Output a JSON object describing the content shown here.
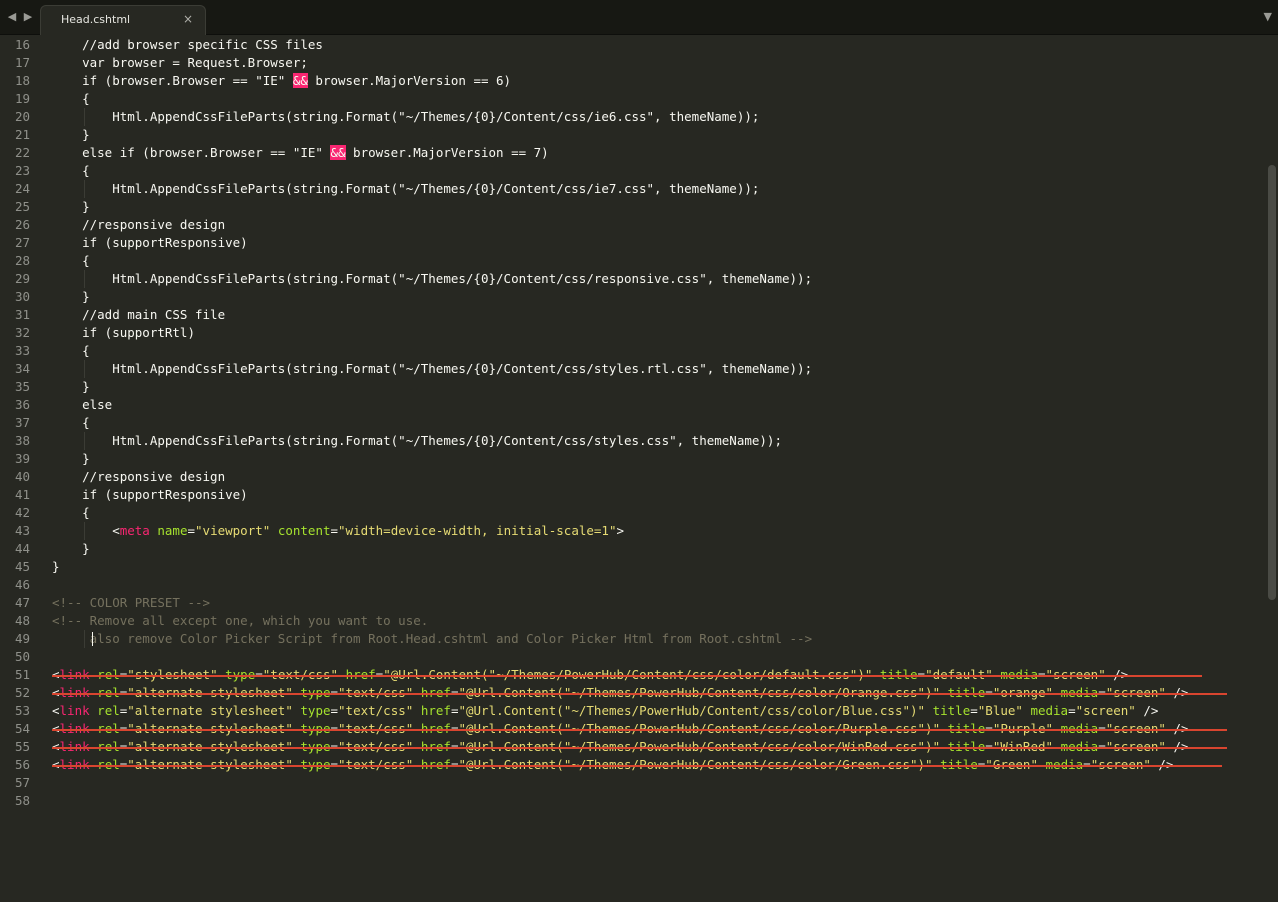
{
  "tabs": [
    {
      "label": "Head.cshtml",
      "close": "×"
    }
  ],
  "nav": {
    "back": "◀",
    "forward": "▶",
    "menu": "▼"
  },
  "lines": [
    {
      "n": "16",
      "html": "    //add browser specific CSS files"
    },
    {
      "n": "17",
      "html": "    var browser = Request.Browser;"
    },
    {
      "n": "18",
      "html": "    if (browser.Browser == \"IE\" <span class=\"amp\">&amp;&amp;</span> browser.MajorVersion == 6)"
    },
    {
      "n": "19",
      "html": "    {"
    },
    {
      "n": "20",
      "html": "        Html.AppendCssFileParts(string.Format(\"~/Themes/{0}/Content/css/ie6.css\", themeName));"
    },
    {
      "n": "21",
      "html": "    }"
    },
    {
      "n": "22",
      "html": "    else if (browser.Browser == \"IE\" <span class=\"amp\">&amp;&amp;</span> browser.MajorVersion == 7)"
    },
    {
      "n": "23",
      "html": "    {"
    },
    {
      "n": "24",
      "html": "        Html.AppendCssFileParts(string.Format(\"~/Themes/{0}/Content/css/ie7.css\", themeName));"
    },
    {
      "n": "25",
      "html": "    }"
    },
    {
      "n": "26",
      "html": "    //responsive design"
    },
    {
      "n": "27",
      "html": "    if (supportResponsive)"
    },
    {
      "n": "28",
      "html": "    {"
    },
    {
      "n": "29",
      "html": "        Html.AppendCssFileParts(string.Format(\"~/Themes/{0}/Content/css/responsive.css\", themeName));"
    },
    {
      "n": "30",
      "html": "    }"
    },
    {
      "n": "31",
      "html": "    //add main CSS file"
    },
    {
      "n": "32",
      "html": "    if (supportRtl)"
    },
    {
      "n": "33",
      "html": "    {"
    },
    {
      "n": "34",
      "html": "        Html.AppendCssFileParts(string.Format(\"~/Themes/{0}/Content/css/styles.rtl.css\", themeName));"
    },
    {
      "n": "35",
      "html": "    }"
    },
    {
      "n": "36",
      "html": "    else"
    },
    {
      "n": "37",
      "html": "    {"
    },
    {
      "n": "38",
      "html": "        Html.AppendCssFileParts(string.Format(\"~/Themes/{0}/Content/css/styles.css\", themeName));"
    },
    {
      "n": "39",
      "html": "    }"
    },
    {
      "n": "40",
      "html": "    //responsive design"
    },
    {
      "n": "41",
      "html": "    if (supportResponsive)"
    },
    {
      "n": "42",
      "html": "    {"
    },
    {
      "n": "43",
      "html": "        &lt;<span class=\"tg\">meta</span> <span class=\"at\">name</span>=<span class=\"st\">\"viewport\"</span> <span class=\"at\">content</span>=<span class=\"st\">\"width=device-width, initial-scale=1\"</span>&gt;"
    },
    {
      "n": "44",
      "html": "    }"
    },
    {
      "n": "45",
      "html": "}"
    },
    {
      "n": "46",
      "html": ""
    },
    {
      "n": "47",
      "html": "&lt;!-- COLOR PRESET --&gt;",
      "dim": true
    },
    {
      "n": "48",
      "html": "&lt;!-- Remove all except one, which you want to use.",
      "dim": true
    },
    {
      "n": "49",
      "html": "     also remove Color Picker Script from Root.Head.cshtml and Color Picker Html from Root.cshtml --&gt;",
      "dim": true
    },
    {
      "n": "50",
      "html": ""
    },
    {
      "n": "51",
      "html": "&lt;<span class=\"tg\">link</span> <span class=\"at\">rel</span>=<span class=\"st\">\"stylesheet\"</span> <span class=\"at\">type</span>=<span class=\"st\">\"text/css\"</span> <span class=\"at\">href</span>=<span class=\"st\">\"@Url.Content(\"~/Themes/PowerHub/Content/css/color/default.css\")\"</span> <span class=\"at\">title</span>=<span class=\"st\">\"default\"</span> <span class=\"at\">media</span>=<span class=\"st\">\"screen\"</span> /&gt;",
      "strike": 1150
    },
    {
      "n": "52",
      "html": "&lt;<span class=\"tg\">link</span> <span class=\"at\">rel</span>=<span class=\"st\">\"alternate stylesheet\"</span> <span class=\"at\">type</span>=<span class=\"st\">\"text/css\"</span> <span class=\"at\">href</span>=<span class=\"st\">\"@Url.Content(\"~/Themes/PowerHub/Content/css/color/Orange.css\")\"</span> <span class=\"at\">title</span>=<span class=\"st\">\"orange\"</span> <span class=\"at\">media</span>=<span class=\"st\">\"screen\"</span> /&gt;",
      "strike": 1175
    },
    {
      "n": "53",
      "html": "&lt;<span class=\"tg\">link</span> <span class=\"at\">rel</span>=<span class=\"st\">\"alternate stylesheet\"</span> <span class=\"at\">type</span>=<span class=\"st\">\"text/css\"</span> <span class=\"at\">href</span>=<span class=\"st\">\"@Url.Content(\"~/Themes/PowerHub/Content/css/color/Blue.css\")\"</span> <span class=\"at\">title</span>=<span class=\"st\">\"Blue\"</span> <span class=\"at\">media</span>=<span class=\"st\">\"screen\"</span> /&gt;"
    },
    {
      "n": "54",
      "html": "&lt;<span class=\"tg\">link</span> <span class=\"at\">rel</span>=<span class=\"st\">\"alternate stylesheet\"</span> <span class=\"at\">type</span>=<span class=\"st\">\"text/css\"</span> <span class=\"at\">href</span>=<span class=\"st\">\"@Url.Content(\"~/Themes/PowerHub/Content/css/color/Purple.css\")\"</span> <span class=\"at\">title</span>=<span class=\"st\">\"Purple\"</span> <span class=\"at\">media</span>=<span class=\"st\">\"screen\"</span> /&gt;",
      "strike": 1175
    },
    {
      "n": "55",
      "html": "&lt;<span class=\"tg\">link</span> <span class=\"at\">rel</span>=<span class=\"st\">\"alternate stylesheet\"</span> <span class=\"at\">type</span>=<span class=\"st\">\"text/css\"</span> <span class=\"at\">href</span>=<span class=\"st\">\"@Url.Content(\"~/Themes/PowerHub/Content/css/color/WinRed.css\")\"</span> <span class=\"at\">title</span>=<span class=\"st\">\"WinRed\"</span> <span class=\"at\">media</span>=<span class=\"st\">\"screen\"</span> /&gt;",
      "strike": 1175
    },
    {
      "n": "56",
      "html": "&lt;<span class=\"tg\">link</span> <span class=\"at\">rel</span>=<span class=\"st\">\"alternate stylesheet\"</span> <span class=\"at\">type</span>=<span class=\"st\">\"text/css\"</span> <span class=\"at\">href</span>=<span class=\"st\">\"@Url.Content(\"~/Themes/PowerHub/Content/css/color/Green.css\")\"</span> <span class=\"at\">title</span>=<span class=\"st\">\"Green\"</span> <span class=\"at\">media</span>=<span class=\"st\">\"screen\"</span> /&gt;",
      "strike": 1170
    },
    {
      "n": "57",
      "html": ""
    },
    {
      "n": "58",
      "html": ""
    }
  ],
  "colors": {
    "background": "#272822",
    "tag": "#f92672",
    "attribute": "#a6e22e",
    "string": "#e6db74",
    "comment": "#75715e",
    "strikethrough": "#d9452f"
  }
}
